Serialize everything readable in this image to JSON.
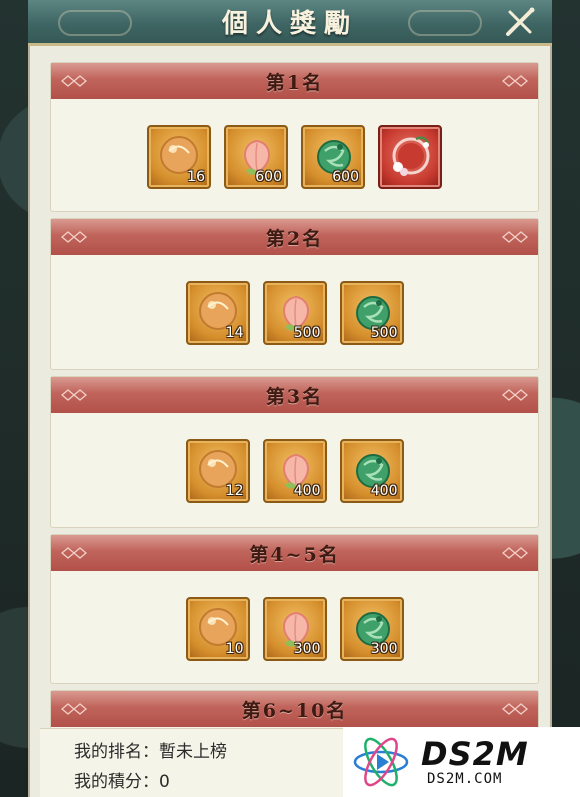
{
  "window": {
    "title": "個人獎勵"
  },
  "sections": [
    {
      "label": "第1名",
      "items": [
        {
          "icon": "pearl-orb-icon",
          "count": "16"
        },
        {
          "icon": "peach-icon",
          "count": "600"
        },
        {
          "icon": "jade-dragon-icon",
          "count": "600"
        },
        {
          "icon": "flower-wreath-frame-icon",
          "count": ""
        }
      ]
    },
    {
      "label": "第2名",
      "items": [
        {
          "icon": "pearl-orb-icon",
          "count": "14"
        },
        {
          "icon": "peach-icon",
          "count": "500"
        },
        {
          "icon": "jade-dragon-icon",
          "count": "500"
        }
      ]
    },
    {
      "label": "第3名",
      "items": [
        {
          "icon": "pearl-orb-icon",
          "count": "12"
        },
        {
          "icon": "peach-icon",
          "count": "400"
        },
        {
          "icon": "jade-dragon-icon",
          "count": "400"
        }
      ]
    },
    {
      "label": "第4~5名",
      "items": [
        {
          "icon": "pearl-orb-icon",
          "count": "10"
        },
        {
          "icon": "peach-icon",
          "count": "300"
        },
        {
          "icon": "jade-dragon-icon",
          "count": "300"
        }
      ]
    },
    {
      "label": "第6~10名",
      "items": []
    }
  ],
  "my_rank": {
    "label": "我的排名：",
    "value": "暫未上榜"
  },
  "my_score": {
    "label": "我的積分：",
    "value": "0"
  },
  "watermark": {
    "brand": "DS2M",
    "site": "DS2M.COM"
  },
  "colors": {
    "header_teal": "#3f6664",
    "section_red": "#c0645b",
    "panel_bg": "#f5f4e8",
    "item_gold": "#d58e2c",
    "item_red": "#c73a2f"
  }
}
